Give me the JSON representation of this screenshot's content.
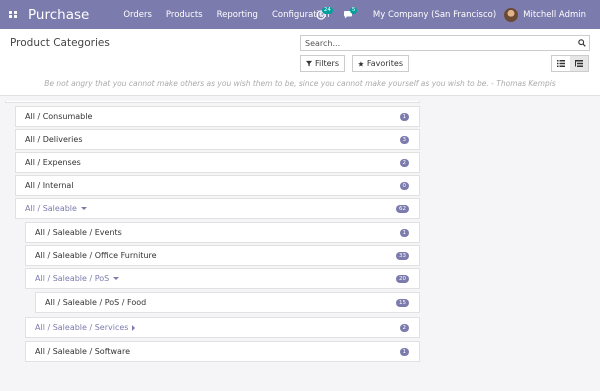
{
  "navbar": {
    "app_title": "Purchase",
    "menu": [
      "Orders",
      "Products",
      "Reporting",
      "Configuration"
    ],
    "activity_count": "24",
    "messages_count": "5",
    "company": "My Company (San Francisco)",
    "user": "Mitchell Admin"
  },
  "control_panel": {
    "breadcrumb": "Product Categories",
    "search_placeholder": "Search...",
    "filters_label": "Filters",
    "favorites_label": "Favorites",
    "quote": "Be not angry that you cannot make others as you wish them to be, since you cannot make yourself as you wish to be. - Thomas Kempis"
  },
  "categories": [
    {
      "label": "All / Consumable",
      "count": "1",
      "level": 0,
      "state": "leaf"
    },
    {
      "label": "All / Deliveries",
      "count": "3",
      "level": 0,
      "state": "leaf"
    },
    {
      "label": "All / Expenses",
      "count": "2",
      "level": 0,
      "state": "leaf"
    },
    {
      "label": "All / Internal",
      "count": "0",
      "level": 0,
      "state": "leaf"
    },
    {
      "label": "All / Saleable",
      "count": "62",
      "level": 0,
      "state": "open"
    },
    {
      "label": "All / Saleable / Events",
      "count": "1",
      "level": 1,
      "state": "leaf"
    },
    {
      "label": "All / Saleable / Office Furniture",
      "count": "33",
      "level": 1,
      "state": "leaf"
    },
    {
      "label": "All / Saleable / PoS",
      "count": "20",
      "level": 1,
      "state": "open"
    },
    {
      "label": "All / Saleable / PoS / Food",
      "count": "15",
      "level": 2,
      "state": "leaf"
    },
    {
      "label": "All / Saleable / Services",
      "count": "2",
      "level": 1,
      "state": "closed"
    },
    {
      "label": "All / Saleable / Software",
      "count": "1",
      "level": 1,
      "state": "leaf"
    }
  ],
  "colors": {
    "brand": "#7c7bad",
    "badge_teal": "#00a09d"
  }
}
